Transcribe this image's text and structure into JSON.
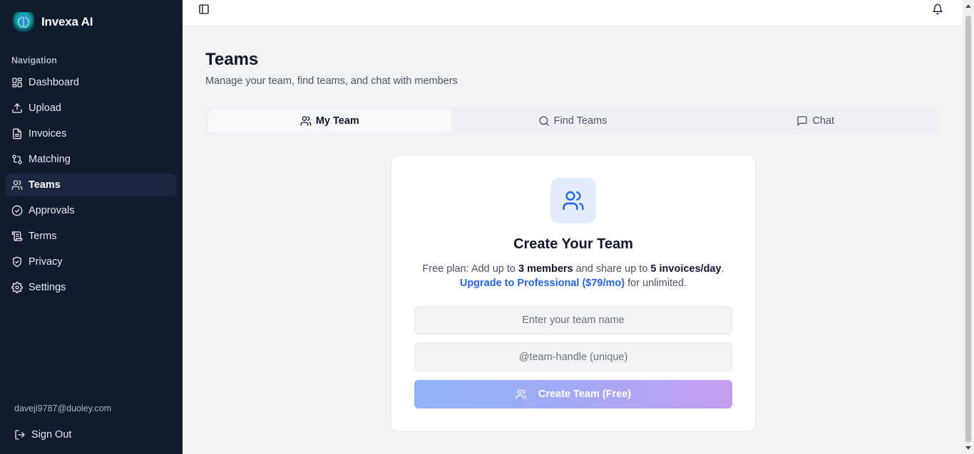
{
  "app": {
    "name": "Invexa AI"
  },
  "sidebar": {
    "heading": "Navigation",
    "items": [
      {
        "label": "Dashboard",
        "icon": "dashboard-icon"
      },
      {
        "label": "Upload",
        "icon": "upload-icon"
      },
      {
        "label": "Invoices",
        "icon": "file-text-icon"
      },
      {
        "label": "Matching",
        "icon": "git-compare-icon"
      },
      {
        "label": "Teams",
        "icon": "users-icon",
        "active": true
      },
      {
        "label": "Approvals",
        "icon": "check-circle-icon"
      },
      {
        "label": "Terms",
        "icon": "scroll-icon"
      },
      {
        "label": "Privacy",
        "icon": "shield-icon"
      },
      {
        "label": "Settings",
        "icon": "gear-icon"
      }
    ],
    "user_email": "daveji9787@duoley.com",
    "signout_label": "Sign Out"
  },
  "page": {
    "title": "Teams",
    "subtitle": "Manage your team, find teams, and chat with members"
  },
  "tabs": [
    {
      "label": "My Team",
      "icon": "users-icon",
      "active": true
    },
    {
      "label": "Find Teams",
      "icon": "search-icon"
    },
    {
      "label": "Chat",
      "icon": "message-square-icon"
    }
  ],
  "card": {
    "title": "Create Your Team",
    "desc_prefix": "Free plan: Add up to ",
    "desc_members": "3 members",
    "desc_middle": " and share up to ",
    "desc_invoices": "5 invoices/day",
    "desc_suffix": ".",
    "upgrade_link": "Upgrade to Professional ($79/mo)",
    "upgrade_suffix": " for unlimited.",
    "team_name_placeholder": "Enter your team name",
    "team_handle_placeholder": "@team-handle (unique)",
    "create_button": "Create Team (Free)"
  },
  "colors": {
    "sidebar_bg": "#111b2e",
    "accent": "#2563eb",
    "button_gradient_start": "#8fb3f7",
    "button_gradient_end": "#c49df1"
  }
}
